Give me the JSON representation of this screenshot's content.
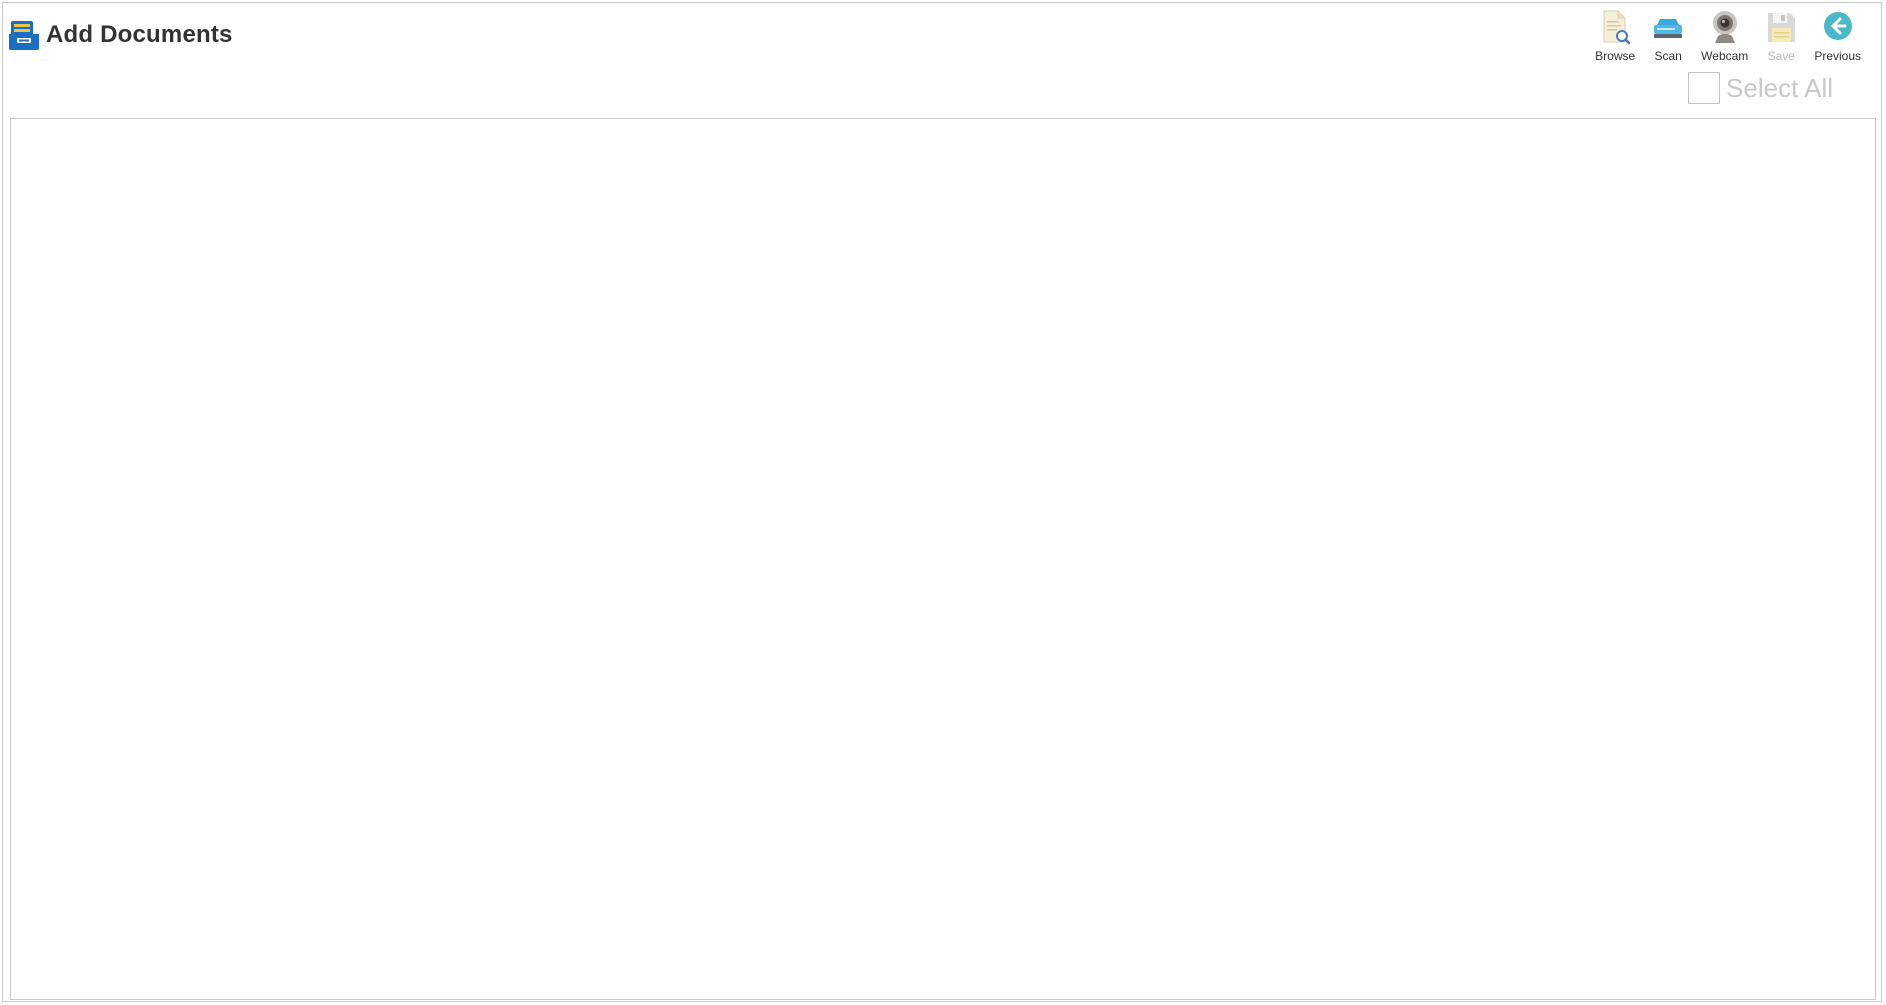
{
  "header": {
    "title": "Add Documents",
    "title_icon": "document-tray-icon"
  },
  "toolbar": {
    "items": [
      {
        "label": "Browse",
        "icon": "browse-document-icon",
        "enabled": true
      },
      {
        "label": "Scan",
        "icon": "scanner-icon",
        "enabled": true
      },
      {
        "label": "Webcam",
        "icon": "webcam-icon",
        "enabled": true
      },
      {
        "label": "Save",
        "icon": "save-floppy-icon",
        "enabled": false
      },
      {
        "label": "Previous",
        "icon": "arrow-left-circle-icon",
        "enabled": true
      }
    ]
  },
  "select_all": {
    "label": "Select All",
    "checked": false,
    "enabled": false
  },
  "colors": {
    "accent_blue": "#1a6fc4",
    "previous_teal": "#4ab8c8",
    "disabled_text": "#b8b8b8"
  }
}
